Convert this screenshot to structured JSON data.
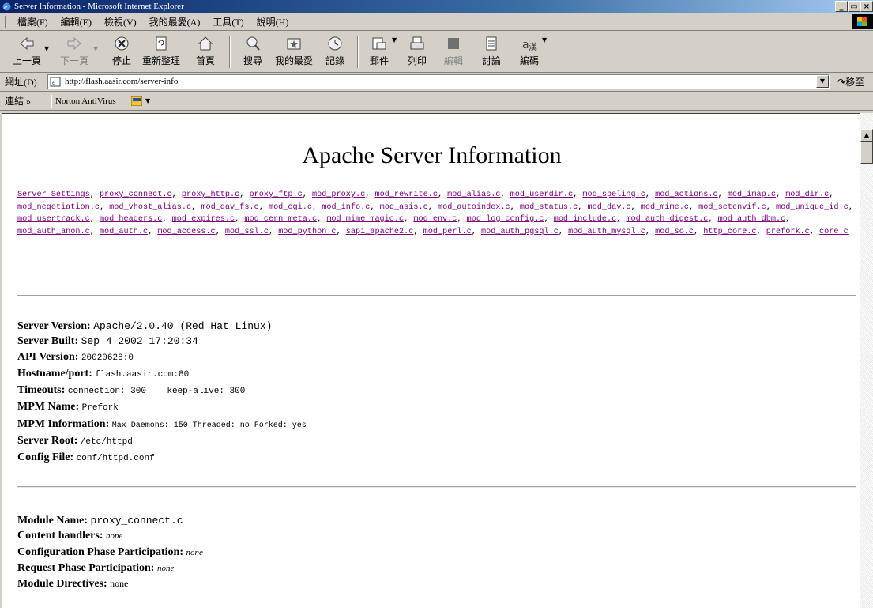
{
  "window": {
    "title": "Server Information - Microsoft Internet Explorer",
    "buttons": [
      "_",
      "̈",
      "X"
    ]
  },
  "menu": [
    "檔案(F)",
    "編輯(E)",
    "檢視(V)",
    "我的最愛(A)",
    "工具(T)",
    "說明(H)"
  ],
  "toolbar": {
    "back": "上一頁",
    "forward": "下一頁",
    "stop": "停止",
    "refresh": "重新整理",
    "home": "首頁",
    "search": "搜尋",
    "favorites": "我的最愛",
    "history": "記錄",
    "mail": "郵件",
    "print": "列印",
    "edit": "編輯",
    "discuss": "討論",
    "encoding": "編碼"
  },
  "address": {
    "label": "網址(D)",
    "url": "http://flash.aasir.com/server-info",
    "go": "移至"
  },
  "links": {
    "label": "連結 »",
    "norton": "Norton AntiVirus"
  },
  "page": {
    "heading": "Apache Server Information",
    "module_links": [
      "Server Settings",
      "proxy_connect.c",
      "proxy_http.c",
      "proxy_ftp.c",
      "mod_proxy.c",
      "mod_rewrite.c",
      "mod_alias.c",
      "mod_userdir.c",
      "mod_speling.c",
      "mod_actions.c",
      "mod_imap.c",
      "mod_dir.c",
      "mod_negotiation.c",
      "mod_vhost_alias.c",
      "mod_dav_fs.c",
      "mod_cgi.c",
      "mod_info.c",
      "mod_asis.c",
      "mod_autoindex.c",
      "mod_status.c",
      "mod_dav.c",
      "mod_mime.c",
      "mod_setenvif.c",
      "mod_unique_id.c",
      "mod_usertrack.c",
      "mod_headers.c",
      "mod_expires.c",
      "mod_cern_meta.c",
      "mod_mime_magic.c",
      "mod_env.c",
      "mod_log_config.c",
      "mod_include.c",
      "mod_auth_digest.c",
      "mod_auth_dbm.c",
      "mod_auth_anon.c",
      "mod_auth.c",
      "mod_access.c",
      "mod_ssl.c",
      "mod_python.c",
      "sapi_apache2.c",
      "mod_perl.c",
      "mod_auth_pgsql.c",
      "mod_auth_mysql.c",
      "mod_so.c",
      "http_core.c",
      "prefork.c",
      "core.c"
    ],
    "server_info": [
      {
        "key": "Server Version:",
        "value": "Apache/2.0.40 (Red Hat Linux)",
        "style": "big"
      },
      {
        "key": "Server Built:",
        "value": "Sep 4 2002 17:20:34",
        "style": "big"
      },
      {
        "key": "API Version:",
        "value": "20020628:0",
        "style": "small"
      },
      {
        "key": "Hostname/port:",
        "value": "flash.aasir.com:80",
        "style": "small"
      },
      {
        "key": "Timeouts:",
        "value": "connection: 300    keep-alive: 300",
        "style": "small"
      },
      {
        "key": "MPM Name:",
        "value": "Prefork",
        "style": "small"
      },
      {
        "key": "MPM Information:",
        "value": "Max Daemons: 150 Threaded: no Forked: yes",
        "style": "tiny"
      },
      {
        "key": "Server Root:",
        "value": "/etc/httpd",
        "style": "small"
      },
      {
        "key": "Config File:",
        "value": "conf/httpd.conf",
        "style": "small"
      }
    ],
    "module_info": [
      {
        "key": "Module Name:",
        "value": "proxy_connect.c",
        "style": "big"
      },
      {
        "key": "Content handlers:",
        "value": "none",
        "style": "it"
      },
      {
        "key": "Configuration Phase Participation:",
        "value": "none",
        "style": "it"
      },
      {
        "key": "Request Phase Participation:",
        "value": "none",
        "style": "it"
      },
      {
        "key": "Module Directives:",
        "value": "none",
        "style": "serif"
      }
    ]
  }
}
